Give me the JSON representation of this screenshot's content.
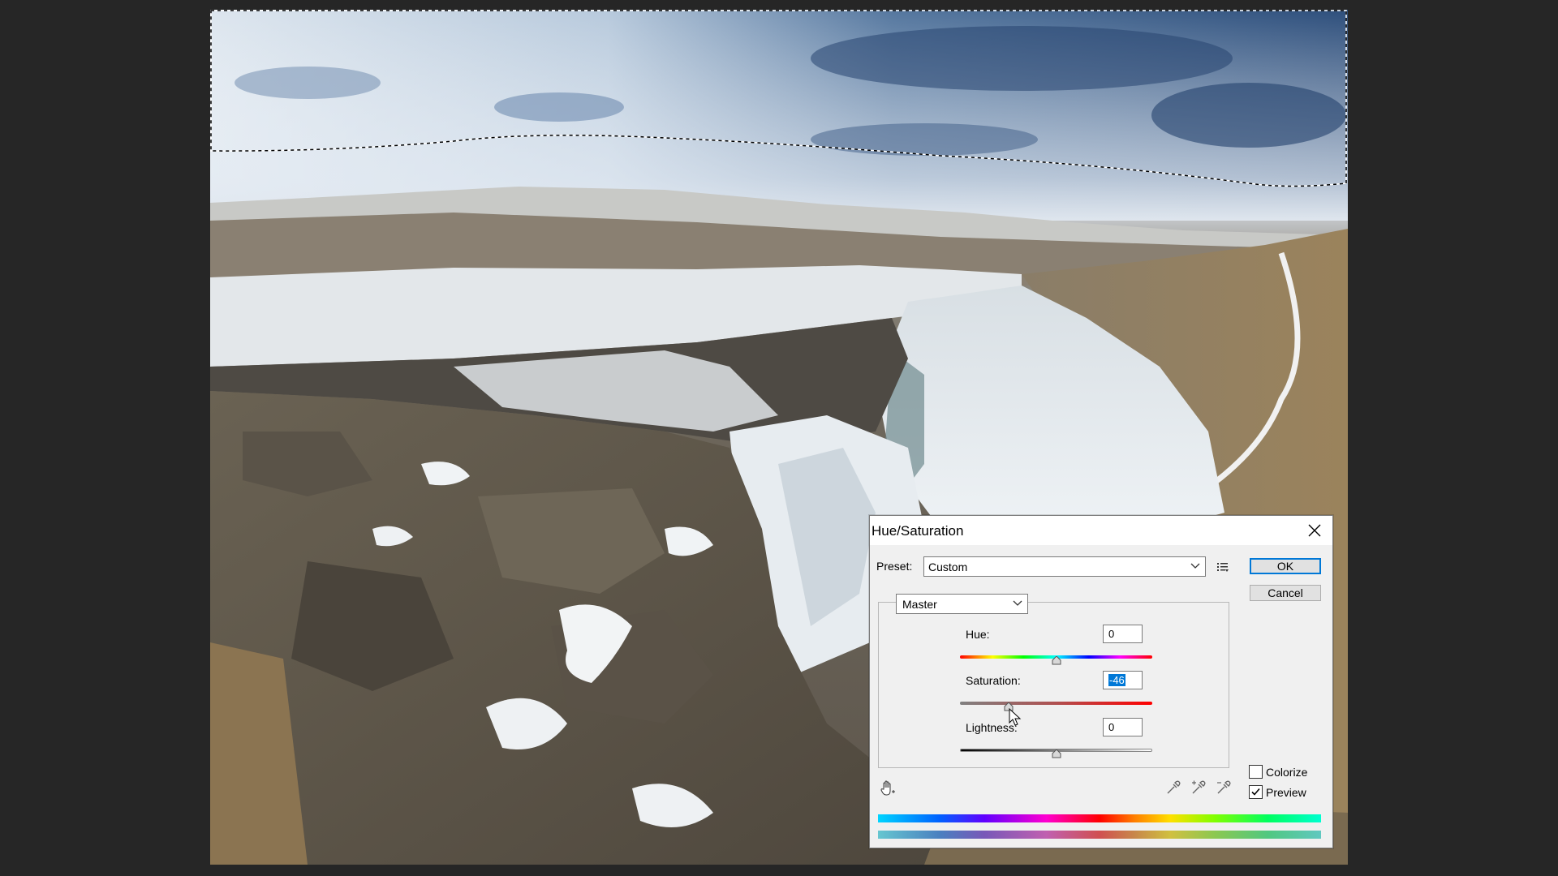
{
  "dialog": {
    "title": "Hue/Saturation",
    "preset_label": "Preset:",
    "preset_value": "Custom",
    "ok_label": "OK",
    "cancel_label": "Cancel",
    "channel_value": "Master",
    "hue_label": "Hue:",
    "hue_value": "0",
    "saturation_label": "Saturation:",
    "saturation_value": "-46",
    "lightness_label": "Lightness:",
    "lightness_value": "0",
    "colorize_label": "Colorize",
    "colorize_checked": false,
    "preview_label": "Preview",
    "preview_checked": true
  },
  "icons": {
    "close": "close-icon",
    "preset_options": "preset-options-icon",
    "hand_tool": "hand-icon",
    "eyedroppers": [
      "eyedropper-icon",
      "eyedropper-plus-icon",
      "eyedropper-minus-icon"
    ]
  },
  "colors": {
    "accent": "#0078d7",
    "dialog_bg": "#f0f0f0",
    "workspace_bg": "#262626"
  }
}
